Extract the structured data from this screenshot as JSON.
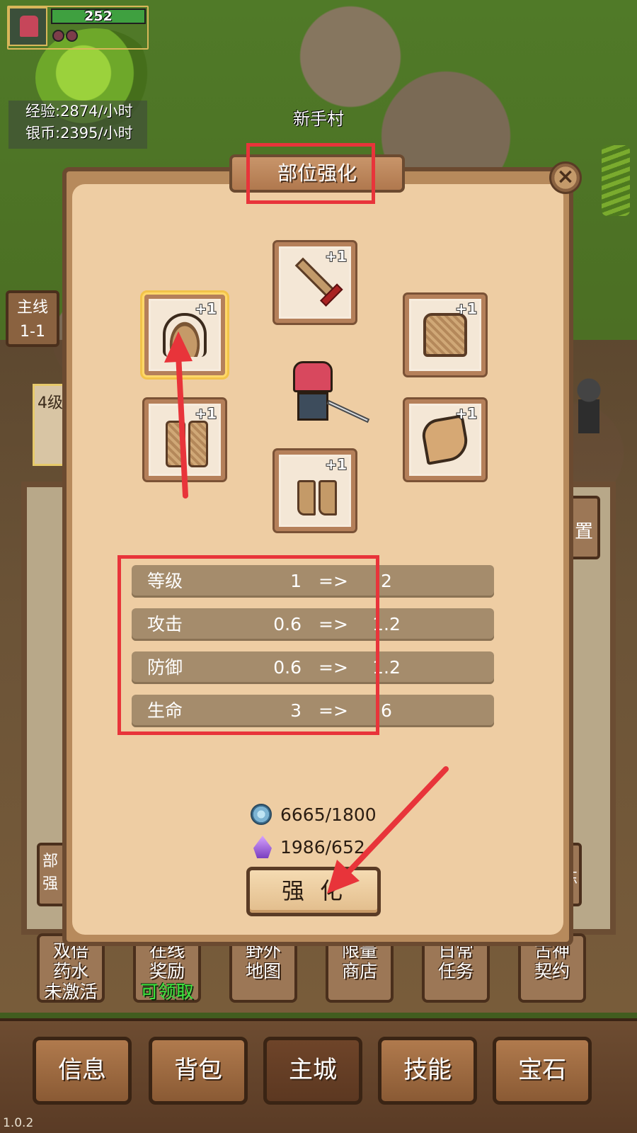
{
  "hud": {
    "hp": "252"
  },
  "rates": {
    "exp": "经验:2874/小时",
    "silver": "银币:2395/小时"
  },
  "location": "新手村",
  "quest_tab": {
    "line1": "主线",
    "line2": "1-1"
  },
  "side": {
    "left_top": "4级",
    "left_bottom": "部强",
    "right_mid": "置",
    "right_bottom": "炼"
  },
  "panel": {
    "title": "部位强化",
    "close_label": "×",
    "selected_slot": "helmet",
    "slots": {
      "weapon": "+1",
      "helmet": "+1",
      "armor": "+1",
      "pants": "+1",
      "cloak": "+1",
      "boots": "+1"
    },
    "stats": [
      {
        "name": "等级",
        "from": "1",
        "arrow": "=>",
        "to": "2"
      },
      {
        "name": "攻击",
        "from": "0.6",
        "arrow": "=>",
        "to": "1.2"
      },
      {
        "name": "防御",
        "from": "0.6",
        "arrow": "=>",
        "to": "1.2"
      },
      {
        "name": "生命",
        "from": "3",
        "arrow": "=>",
        "to": "6"
      }
    ],
    "costs": {
      "coin": "6665/1800",
      "crystal": "1986/652"
    },
    "enhance_button": "强化"
  },
  "activities": [
    {
      "l1": "双倍",
      "l2": "药水",
      "status": "未激活",
      "status_state": "inactive"
    },
    {
      "l1": "在线",
      "l2": "奖励",
      "status": "可领取",
      "status_state": "claimable"
    },
    {
      "l1": "野外",
      "l2": "地图",
      "status": "",
      "status_state": ""
    },
    {
      "l1": "限量",
      "l2": "商店",
      "status": "",
      "status_state": ""
    },
    {
      "l1": "日常",
      "l2": "任务",
      "status": "",
      "status_state": ""
    },
    {
      "l1": "古神",
      "l2": "契约",
      "status": "",
      "status_state": ""
    }
  ],
  "bottom_nav": [
    "信息",
    "背包",
    "主城",
    "技能",
    "宝石"
  ],
  "bottom_nav_active": "主城",
  "version": "1.0.2",
  "colors": {
    "highlight": "#e8343a",
    "claimable": "#3ee83e",
    "panel_bg": "#eecda3"
  },
  "icons": {
    "weapon": "sword-icon",
    "helmet": "helmet-icon",
    "armor": "armor-icon",
    "pants": "pants-icon",
    "cloak": "cloak-icon",
    "boots": "boots-icon",
    "coin": "coin-icon",
    "crystal": "crystal-icon"
  }
}
